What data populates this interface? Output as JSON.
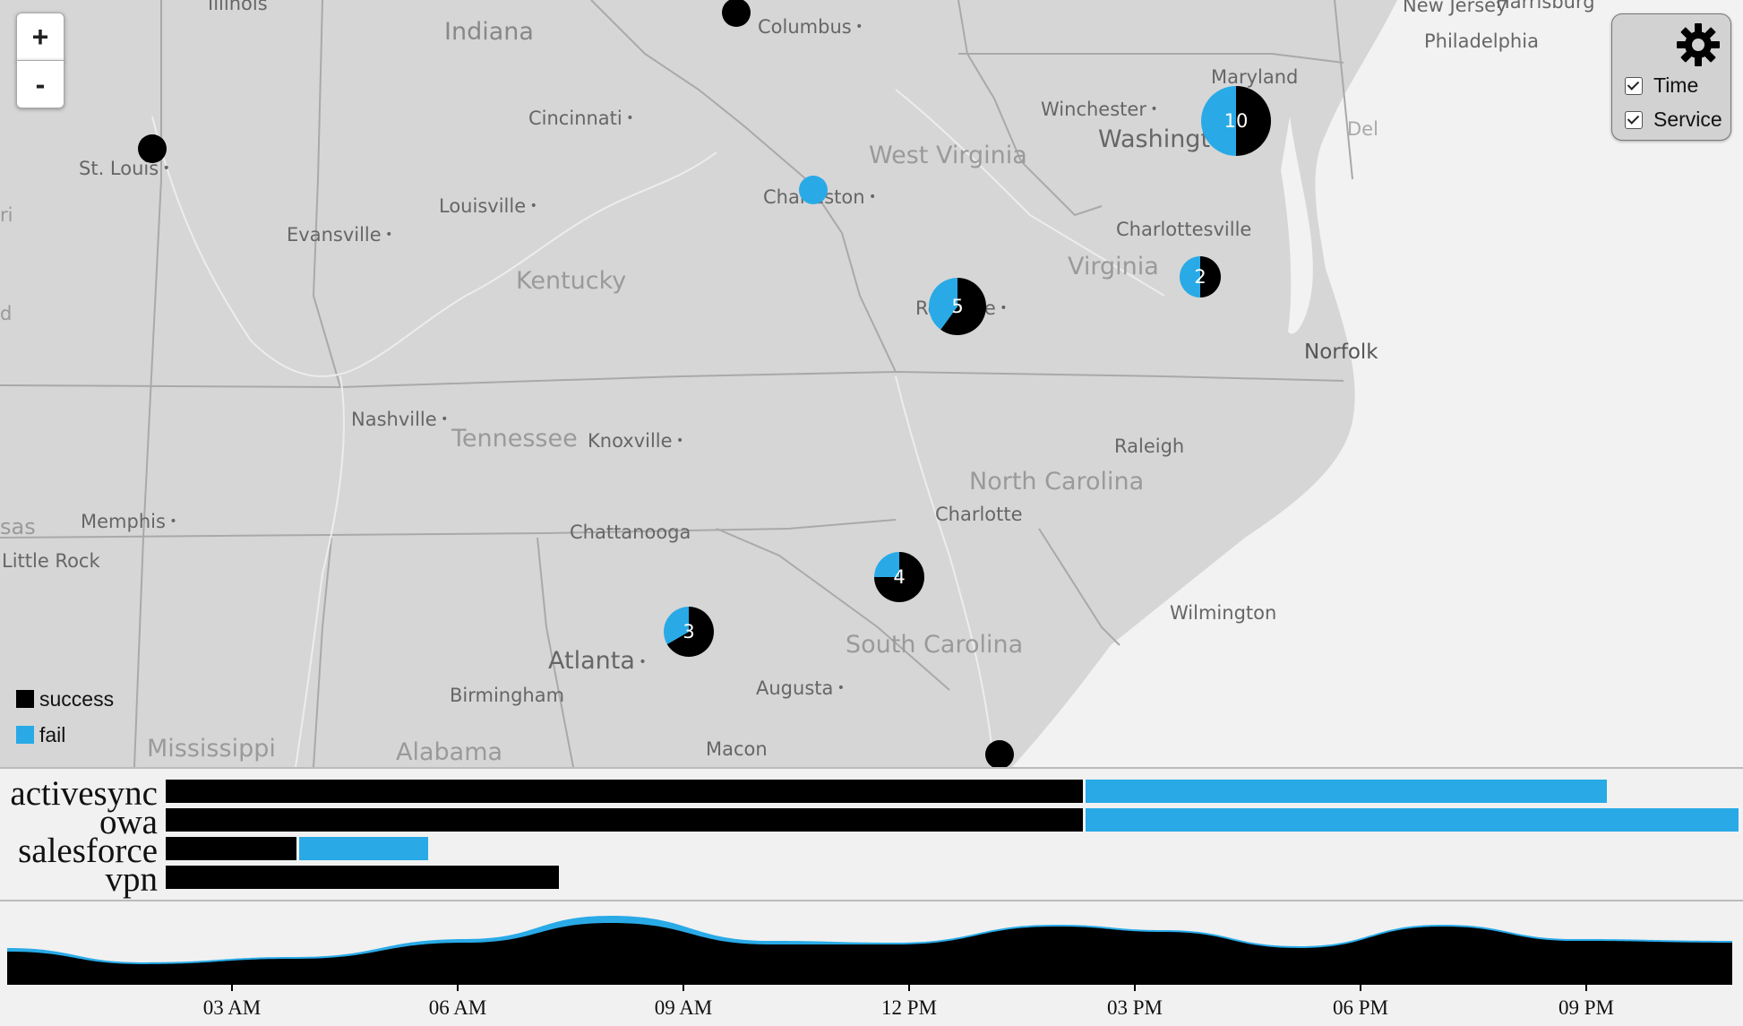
{
  "map": {
    "zoom_in_label": "+",
    "zoom_out_label": "-",
    "places": {
      "illinois": "Illinois",
      "indiana": "Indiana",
      "columbus": "Columbus",
      "harrisburg": "Harrisburg",
      "new_jersey": "New Jersey",
      "philadelphia": "Philadelphia",
      "st_louis": "St. Louis",
      "cincinnati": "Cincinnati",
      "winchester": "Winchester",
      "maryland": "Maryland",
      "washington": "Washington",
      "delaware": "Del",
      "louisville": "Louisville",
      "charleston": "Charleston",
      "west_virginia": "West Virginia",
      "evansville": "Evansville",
      "charlottesville": "Charlottesville",
      "kentucky": "Kentucky",
      "virginia": "Virginia",
      "roanoke": "Roanoke",
      "norfolk": "Norfolk",
      "nashville": "Nashville",
      "tennessee": "Tennessee",
      "knoxville": "Knoxville",
      "raleigh": "Raleigh",
      "north_carolina": "North Carolina",
      "memphis": "Memphis",
      "charlotte": "Charlotte",
      "chattanooga": "Chattanooga",
      "little_rock": "Little Rock",
      "wilmington": "Wilmington",
      "south_carolina": "South Carolina",
      "atlanta": "Atlanta",
      "birmingham": "Birmingham",
      "augusta": "Augusta",
      "mississippi": "Mississippi",
      "alabama": "Alabama",
      "macon": "Macon",
      "ri": "ri",
      "d": "d",
      "sas": "sas"
    },
    "markers": [
      {
        "id": "columbus",
        "count": 1,
        "success": 1,
        "fail": 0,
        "label": ""
      },
      {
        "id": "st-louis",
        "count": 1,
        "success": 1,
        "fail": 0,
        "label": ""
      },
      {
        "id": "charleston",
        "count": 1,
        "success": 0,
        "fail": 1,
        "label": ""
      },
      {
        "id": "washington",
        "count": 10,
        "success": 5,
        "fail": 5,
        "label": "10"
      },
      {
        "id": "charlottesville-area",
        "count": 2,
        "success": 1,
        "fail": 1,
        "label": "2"
      },
      {
        "id": "roanoke",
        "count": 5,
        "success": 3,
        "fail": 2,
        "label": "5"
      },
      {
        "id": "south-carolina-north",
        "count": 4,
        "success": 3,
        "fail": 1,
        "label": "4"
      },
      {
        "id": "atlanta-east",
        "count": 3,
        "success": 2,
        "fail": 1,
        "label": "3"
      },
      {
        "id": "coast-south",
        "count": 1,
        "success": 1,
        "fail": 0,
        "label": ""
      }
    ]
  },
  "settings": {
    "time_label": "Time",
    "service_label": "Service",
    "time_checked": true,
    "service_checked": true
  },
  "legend": {
    "success_label": "success",
    "fail_label": "fail"
  },
  "colors": {
    "success": "#000000",
    "fail": "#29aae7",
    "map_bg": "#d6d6d6",
    "panel_bg": "#f1f1f1"
  },
  "services": [
    {
      "name": "activesync",
      "success": 7,
      "fail": 4
    },
    {
      "name": "owa",
      "success": 7,
      "fail": 5
    },
    {
      "name": "salesforce",
      "success": 1,
      "fail": 1
    },
    {
      "name": "vpn",
      "success": 3,
      "fail": 0
    }
  ],
  "timeline": {
    "ticks": [
      "03 AM",
      "06 AM",
      "09 AM",
      "12 PM",
      "03 PM",
      "06 PM",
      "09 PM"
    ]
  }
}
